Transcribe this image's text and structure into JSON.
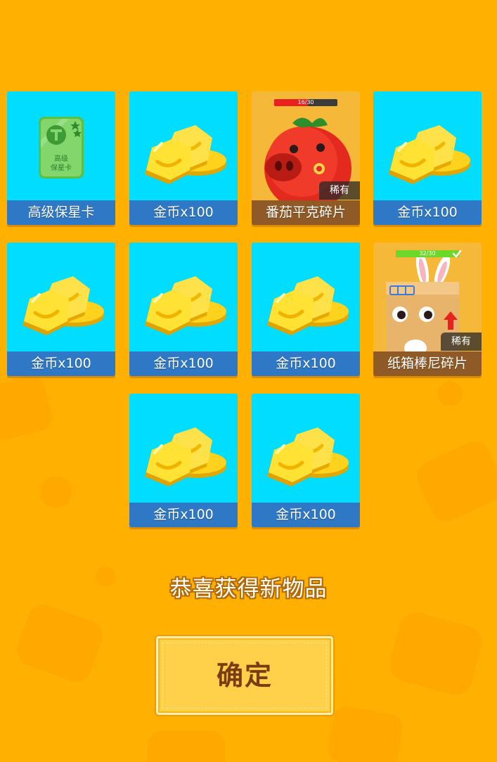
{
  "colors": {
    "background": "#FFB000",
    "common_card": "#00DDFF",
    "common_label": "#2E78C6",
    "rare_card": "#F6B838",
    "rare_label": "#8F5A26",
    "progress_red": "#E8201E",
    "progress_green": "#6CD92A",
    "button_text": "#7A3C12"
  },
  "rewards": [
    {
      "label": "高级保星卡",
      "icon": "star-protection-card-icon",
      "card_text": "高级\n保星卡",
      "rarity": "common"
    },
    {
      "label": "金币x100",
      "icon": "gold-coins-icon",
      "rarity": "common"
    },
    {
      "label": "番茄平克碎片",
      "icon": "tomato-pig-character-icon",
      "rarity": "rare",
      "rare_tag": "稀有",
      "progress_text": "16/30",
      "progress": 0.533
    },
    {
      "label": "金币x100",
      "icon": "gold-coins-icon",
      "rarity": "common"
    },
    {
      "label": "金币x100",
      "icon": "gold-coins-icon",
      "rarity": "common"
    },
    {
      "label": "金币x100",
      "icon": "gold-coins-icon",
      "rarity": "common"
    },
    {
      "label": "金币x100",
      "icon": "gold-coins-icon",
      "rarity": "common"
    },
    {
      "label": "纸箱棒尼碎片",
      "icon": "cardboard-bunny-character-icon",
      "rarity": "rare",
      "rare_tag": "稀有",
      "progress_text": "32/30",
      "progress": 1.0
    },
    {
      "label": "金币x100",
      "icon": "gold-coins-icon",
      "rarity": "common"
    },
    {
      "label": "金币x100",
      "icon": "gold-coins-icon",
      "rarity": "common"
    }
  ],
  "congrats_text": "恭喜获得新物品",
  "confirm_label": "确定"
}
